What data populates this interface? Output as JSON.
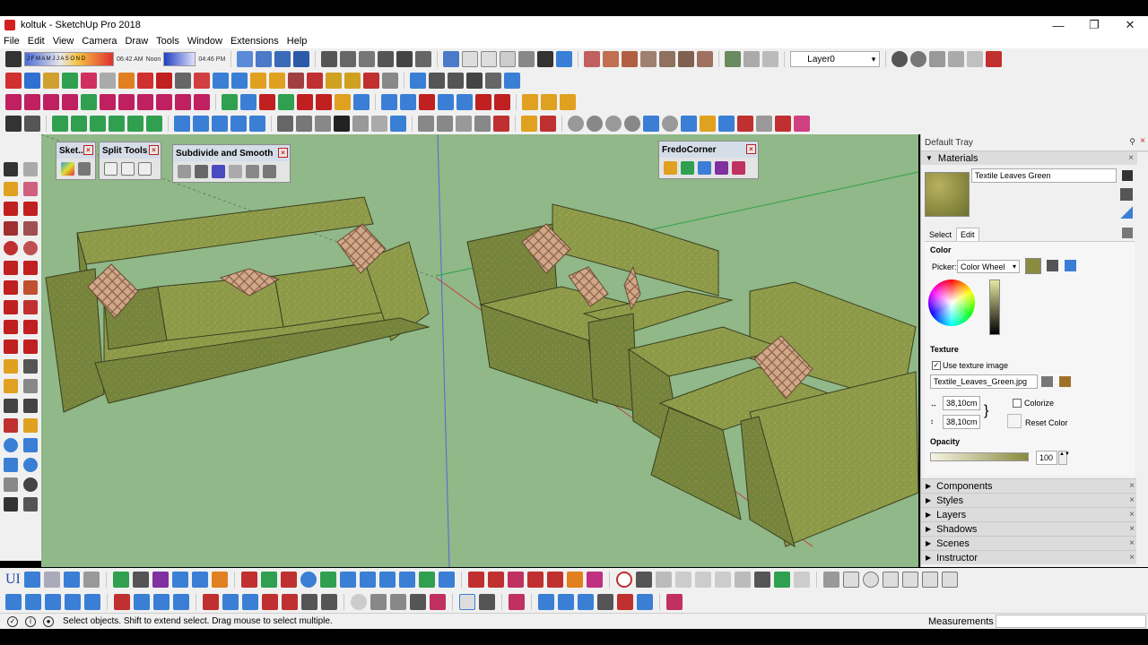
{
  "window": {
    "title": "koltuk - SketchUp Pro 2018",
    "minimize": "—",
    "restore": "❐",
    "close": "✕"
  },
  "menu": [
    "File",
    "Edit",
    "View",
    "Camera",
    "Draw",
    "Tools",
    "Window",
    "Extensions",
    "Help"
  ],
  "shadow_toolbar": {
    "months": "J F M A M J J A S O N D",
    "time_start": "06:42 AM",
    "time_noon": "Noon",
    "time_end": "04:46 PM"
  },
  "layer_select": {
    "value": "Layer0"
  },
  "floating_toolbars": {
    "sketchup": "Sket...",
    "split_tools": "Split Tools",
    "subdivide": "Subdivide and Smooth",
    "fredocorner": "FredoCorner",
    "close_glyph": "×"
  },
  "tray": {
    "title": "Default Tray",
    "pin": "⚲",
    "close": "×",
    "materials_section": "Materials",
    "material_name": "Textile Leaves Green",
    "tabs": {
      "select": "Select",
      "edit": "Edit"
    },
    "color_heading": "Color",
    "picker_label": "Picker:",
    "picker_value": "Color Wheel",
    "texture_heading": "Texture",
    "use_texture_label": "Use texture image",
    "texture_file": "Textile_Leaves_Green.jpg",
    "width_value": "38,10cm",
    "height_value": "38,10cm",
    "colorize_label": "Colorize",
    "reset_color_label": "Reset Color",
    "opacity_heading": "Opacity",
    "opacity_value": "100",
    "collapsed_sections": [
      "Components",
      "Styles",
      "Layers",
      "Shadows",
      "Scenes",
      "Instructor"
    ]
  },
  "bottom_toolbar": {
    "ui_label": "UI"
  },
  "status": {
    "message": "Select objects. Shift to extend select. Drag mouse to select multiple.",
    "measurements_label": "Measurements",
    "measurements_value": ""
  },
  "colors": {
    "viewport_bg": "#90b888",
    "sofa_fabric": "#8c9a48",
    "pillow": "#c8a080",
    "accent_blue": "#3a7fd5"
  }
}
